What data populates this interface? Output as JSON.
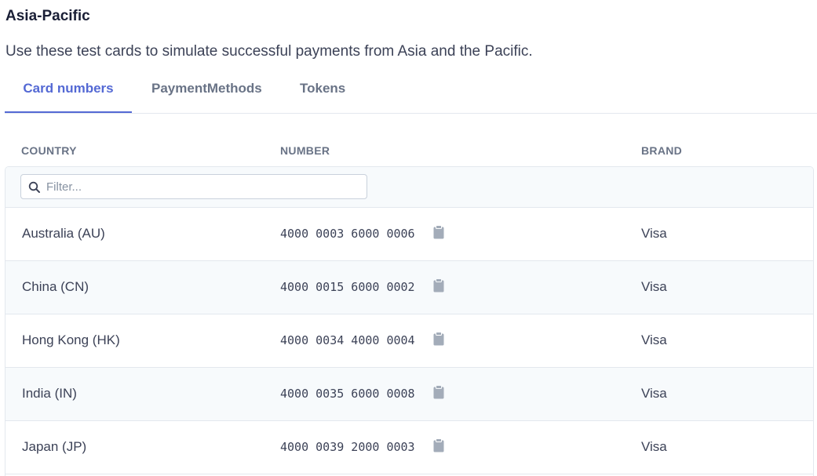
{
  "section": {
    "title": "Asia-Pacific",
    "description": "Use these test cards to simulate successful payments from Asia and the Pacific."
  },
  "tabs": [
    {
      "label": "Card numbers",
      "active": true
    },
    {
      "label": "PaymentMethods",
      "active": false
    },
    {
      "label": "Tokens",
      "active": false
    }
  ],
  "table": {
    "columns": [
      "COUNTRY",
      "NUMBER",
      "BRAND"
    ],
    "filter": {
      "placeholder": "Filter...",
      "value": ""
    },
    "rows": [
      {
        "country": "Australia (AU)",
        "number": "4000 0003 6000 0006",
        "brand": "Visa"
      },
      {
        "country": "China (CN)",
        "number": "4000 0015 6000 0002",
        "brand": "Visa"
      },
      {
        "country": "Hong Kong (HK)",
        "number": "4000 0034 4000 0004",
        "brand": "Visa"
      },
      {
        "country": "India (IN)",
        "number": "4000 0035 6000 0008",
        "brand": "Visa"
      },
      {
        "country": "Japan (JP)",
        "number": "4000 0039 2000 0003",
        "brand": "Visa"
      }
    ]
  },
  "icons": {
    "filter": "search-icon",
    "copy": "clipboard-icon"
  },
  "colors": {
    "accent": "#5469d4",
    "muted": "#697386",
    "border": "#e3e8ee",
    "row_alt": "#f7fafc",
    "icon": "#a3acb9"
  }
}
